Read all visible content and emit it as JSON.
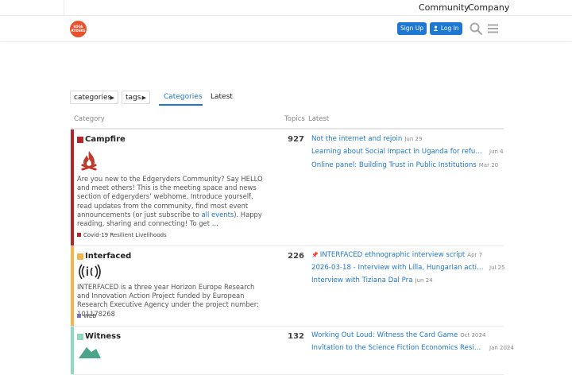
{
  "top_nav": {
    "community": "Community",
    "company": "Company"
  },
  "header": {
    "logo_text": "EDGE RYDERS",
    "signup": "Sign Up",
    "login": "Log In"
  },
  "nav": {
    "categories_drop": "categories",
    "tags_drop": "tags",
    "tab_categories": "Categories",
    "tab_latest": "Latest"
  },
  "table": {
    "col_category": "Category",
    "col_topics": "Topics",
    "col_latest": "Latest"
  },
  "categories": [
    {
      "name": "Campfire",
      "color": "#b3262c",
      "topics": "927",
      "desc_pre": "Are you new to the Edgeryders Community? Say HELLO and meet others! This is the meeting space and news section of edgeryders’ webhome. Introduce yourself, read updates from the community, find most event announcements (or just subscribe to ",
      "desc_link": "all events",
      "desc_post": "). Happy reading, sharing and connecting! To get …",
      "sub": {
        "name": "Covid-19 Resilient Livelihoods",
        "color": "#b3262c"
      },
      "latest": [
        {
          "title": "Not the internet and rejoin",
          "date": "Jun 29"
        },
        {
          "title": "Learning about Social Impact in Uganda for refugees…",
          "date": "Jun 4"
        },
        {
          "title": "Online panel: Building Trust in Public Institutions",
          "date": "Mar 20"
        }
      ]
    },
    {
      "name": "Interfaced",
      "color": "#f7b34a",
      "topics": "226",
      "desc_pre": "INTERFACED is a three year Horizon Europe Research and Innovation Action Project funded by European Research Executive Agency under the project number: 101178268",
      "desc_link": "",
      "desc_post": "",
      "sub": {
        "name": "WEB",
        "color": "#7b72b8"
      },
      "latest": [
        {
          "title": "INTERFACED ethnographic interview script",
          "date": "Apr 7",
          "pinned": true
        },
        {
          "title": "2026-03-18 - Interview with Lilla, Hungarian activist…",
          "date": "Jul 25"
        },
        {
          "title": "Interview with Tiziana Dal Pra",
          "date": "Jun 24"
        }
      ]
    },
    {
      "name": "Witness",
      "color": "#8fd9c1",
      "topics": "132",
      "latest": [
        {
          "title": "Working Out Loud: Witness the Card Game",
          "date": "Oct 2024"
        },
        {
          "title": "Invitation to the Science Fiction Economics Resid…",
          "date": "Jan 2024"
        }
      ]
    }
  ]
}
